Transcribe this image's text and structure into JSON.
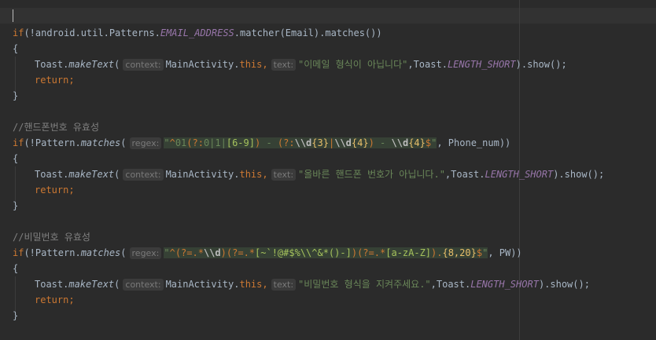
{
  "editor": {
    "block1": {
      "kw_if": "if",
      "paren_open": "(!android.util.Patterns.",
      "field": "EMAIL_ADDRESS",
      "call": ".matcher(Email).matches())",
      "brace_open": "{",
      "toast": "Toast.",
      "make_text": "makeText",
      "paren": "(",
      "hint_context": "context:",
      "activity": "MainActivity.",
      "kw_this": "this",
      "comma": ",",
      "hint_text": "text:",
      "message": "\"이메일 형식이 아닙니다\"",
      "toast_class": ",Toast.",
      "length": "LENGTH_SHORT",
      "show": ").show();",
      "kw_return": "return;",
      "brace_close": "}"
    },
    "block2": {
      "comment": "//핸드폰번호 유효성",
      "kw_if": "if",
      "pattern": "(!Pattern.",
      "matches": "matches",
      "paren": "(",
      "hint_regex": "regex:",
      "regex": {
        "q1": "\"",
        "caret": "^",
        "d1": "01",
        "g1o": "(?:",
        "alt": "0|1|",
        "cls1": "[6-9]",
        "g1c": ")",
        "sep1": " - ",
        "g2o": "(?:",
        "d3": "\\\\d",
        "q3": "{3}",
        "bar": "|",
        "d4": "\\\\d",
        "q4": "{4}",
        "g2c": ")",
        "sep2": " - ",
        "d5": "\\\\d",
        "q5": "{4}",
        "dollar": "$",
        "q2": "\""
      },
      "args_end": ", Phone_num))",
      "brace_open": "{",
      "toast": "Toast.",
      "make_text": "makeText",
      "hint_context": "context:",
      "activity": "MainActivity.",
      "kw_this": "this",
      "comma": ",",
      "hint_text": "text:",
      "message": "\"올바른 핸드폰 번호가 아닙니다.\"",
      "toast_class": ",Toast.",
      "length": "LENGTH_SHORT",
      "show": ").show();",
      "kw_return": "return;",
      "brace_close": "}"
    },
    "block3": {
      "comment": "//비밀번호 유효성",
      "kw_if": "if",
      "pattern": "(!Pattern.",
      "matches": "matches",
      "paren": "(",
      "hint_regex": "regex:",
      "regex": {
        "q1": "\"",
        "caret": "^",
        "la1o": "(?=",
        "any1": ".*",
        "d": "\\\\d",
        "la1c": ")",
        "la2o": "(?=",
        "any2": ".*",
        "cls1": "[~`!@#$%\\\\^&*()-]",
        "la2c": ")",
        "la3o": "(?=",
        "any3": ".*",
        "cls2": "[a-zA-Z]",
        "la3c": ")",
        "dot": ".",
        "quant": "{8,20}",
        "dollar": "$",
        "q2": "\""
      },
      "args_end": ", PW))",
      "brace_open": "{",
      "toast": "Toast.",
      "make_text": "makeText",
      "hint_context": "context:",
      "activity": "MainActivity.",
      "kw_this": "this",
      "comma": ",",
      "hint_text": "text:",
      "message": "\"비밀번호 형식을 지켜주세요.\"",
      "toast_class": ",Toast.",
      "length": "LENGTH_SHORT",
      "show": ").show();",
      "kw_return": "return;",
      "brace_close": "}"
    }
  }
}
